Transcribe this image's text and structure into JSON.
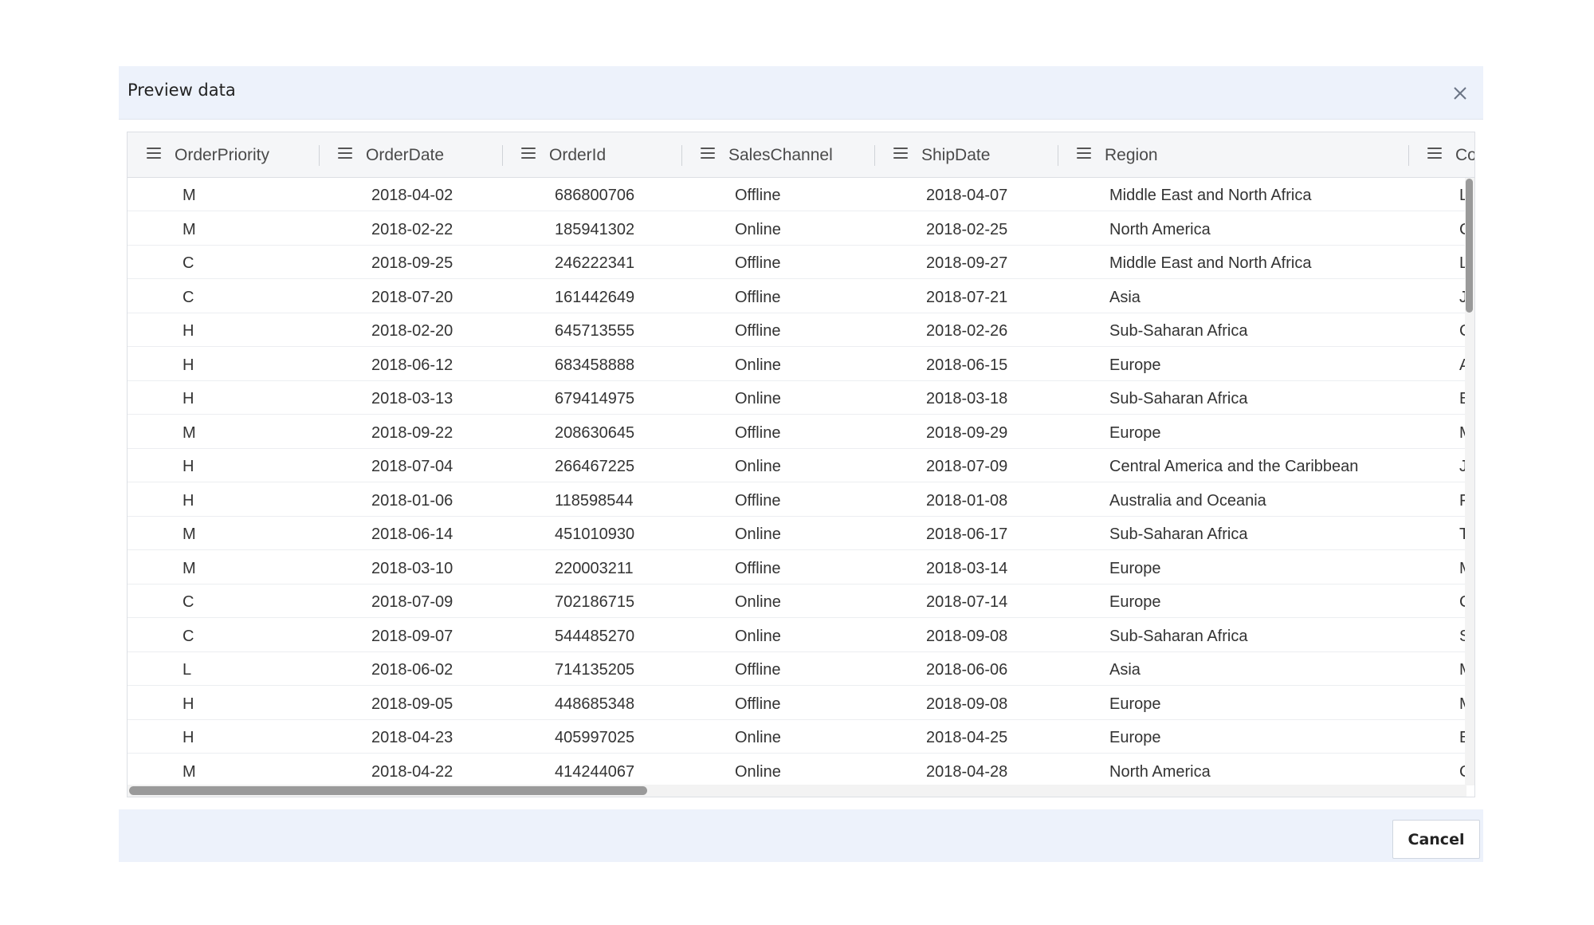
{
  "dialog": {
    "title": "Preview data",
    "cancel_label": "Cancel"
  },
  "icons": {
    "close": "close-icon",
    "column_menu": "column-menu-icon"
  },
  "columns": [
    {
      "key": "OrderPriority",
      "label": "OrderPriority"
    },
    {
      "key": "OrderDate",
      "label": "OrderDate"
    },
    {
      "key": "OrderId",
      "label": "OrderId"
    },
    {
      "key": "SalesChannel",
      "label": "SalesChannel"
    },
    {
      "key": "ShipDate",
      "label": "ShipDate"
    },
    {
      "key": "Region",
      "label": "Region"
    },
    {
      "key": "Country",
      "label": "Cou"
    }
  ],
  "rows": [
    [
      "M",
      "2018-04-02",
      "686800706",
      "Offline",
      "2018-04-07",
      "Middle East and North Africa",
      "L"
    ],
    [
      "M",
      "2018-02-22",
      "185941302",
      "Online",
      "2018-02-25",
      "North America",
      "C"
    ],
    [
      "C",
      "2018-09-25",
      "246222341",
      "Offline",
      "2018-09-27",
      "Middle East and North Africa",
      "L"
    ],
    [
      "C",
      "2018-07-20",
      "161442649",
      "Offline",
      "2018-07-21",
      "Asia",
      "J"
    ],
    [
      "H",
      "2018-02-20",
      "645713555",
      "Offline",
      "2018-02-26",
      "Sub-Saharan Africa",
      "C"
    ],
    [
      "H",
      "2018-06-12",
      "683458888",
      "Online",
      "2018-06-15",
      "Europe",
      "A"
    ],
    [
      "H",
      "2018-03-13",
      "679414975",
      "Online",
      "2018-03-18",
      "Sub-Saharan Africa",
      "E"
    ],
    [
      "M",
      "2018-09-22",
      "208630645",
      "Offline",
      "2018-09-29",
      "Europe",
      "M"
    ],
    [
      "H",
      "2018-07-04",
      "266467225",
      "Online",
      "2018-07-09",
      "Central America and the Caribbean",
      "J"
    ],
    [
      "H",
      "2018-01-06",
      "118598544",
      "Offline",
      "2018-01-08",
      "Australia and Oceania",
      "F"
    ],
    [
      "M",
      "2018-06-14",
      "451010930",
      "Online",
      "2018-06-17",
      "Sub-Saharan Africa",
      "T"
    ],
    [
      "M",
      "2018-03-10",
      "220003211",
      "Offline",
      "2018-03-14",
      "Europe",
      "M"
    ],
    [
      "C",
      "2018-07-09",
      "702186715",
      "Online",
      "2018-07-14",
      "Europe",
      "C"
    ],
    [
      "C",
      "2018-09-07",
      "544485270",
      "Online",
      "2018-09-08",
      "Sub-Saharan Africa",
      "S"
    ],
    [
      "L",
      "2018-06-02",
      "714135205",
      "Offline",
      "2018-06-06",
      "Asia",
      "M"
    ],
    [
      "H",
      "2018-09-05",
      "448685348",
      "Offline",
      "2018-09-08",
      "Europe",
      "M"
    ],
    [
      "H",
      "2018-04-23",
      "405997025",
      "Online",
      "2018-04-25",
      "Europe",
      "E"
    ],
    [
      "M",
      "2018-04-22",
      "414244067",
      "Online",
      "2018-04-28",
      "North America",
      "C"
    ]
  ]
}
